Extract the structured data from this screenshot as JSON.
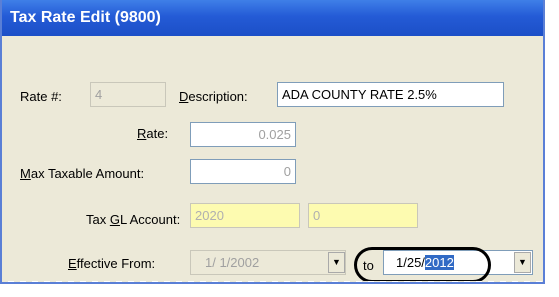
{
  "window": {
    "title": "Tax Rate Edit (9800)"
  },
  "form": {
    "rate_num": {
      "label_pre": "Rate #:",
      "value": "4"
    },
    "description": {
      "label_pre": "",
      "label_u": "D",
      "label_post": "escription:",
      "value": "ADA COUNTY RATE 2.5%"
    },
    "rate": {
      "label_u": "R",
      "label_post": "ate:",
      "value": "0.025"
    },
    "max_taxable": {
      "label_u": "M",
      "label_post": "ax Taxable Amount:",
      "value": "0"
    },
    "tax_gl": {
      "label_pre": "Tax ",
      "label_u": "G",
      "label_post": "L Account:",
      "value1": "2020",
      "value2": "0"
    },
    "effective": {
      "label_u": "E",
      "label_post": "ffective From:",
      "from_value": "1/ 1/2002",
      "to_label": "to",
      "to_value_pre": "1/25/",
      "to_value_sel": "2012"
    }
  }
}
